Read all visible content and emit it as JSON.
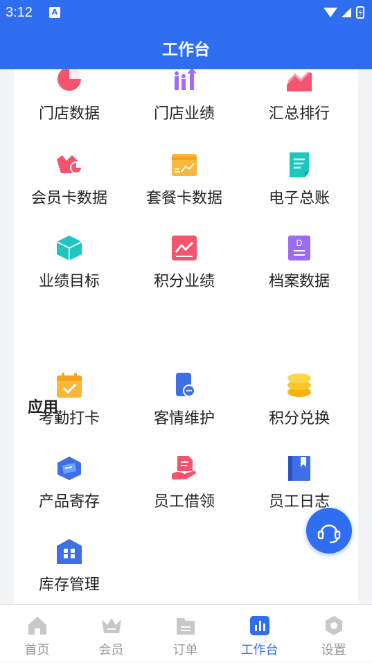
{
  "status_bar": {
    "time": "3:12",
    "sim_label": "A"
  },
  "header": {
    "title": "工作台"
  },
  "grid1": [
    {
      "label": "门店数据",
      "icon": "pie-chart-icon"
    },
    {
      "label": "门店业绩",
      "icon": "people-growth-icon"
    },
    {
      "label": "汇总排行",
      "icon": "trend-chart-icon"
    },
    {
      "label": "会员卡数据",
      "icon": "crown-chart-icon"
    },
    {
      "label": "套餐卡数据",
      "icon": "card-trend-icon"
    },
    {
      "label": "电子总账",
      "icon": "ledger-icon"
    },
    {
      "label": "业绩目标",
      "icon": "box-icon"
    },
    {
      "label": "积分业绩",
      "icon": "line-chart-icon"
    },
    {
      "label": "档案数据",
      "icon": "document-icon"
    }
  ],
  "apps_section": {
    "title": "应用"
  },
  "grid2": [
    {
      "label": "考勤打卡",
      "icon": "calendar-check-icon"
    },
    {
      "label": "客情维护",
      "icon": "phone-chat-icon"
    },
    {
      "label": "积分兑换",
      "icon": "coins-stack-icon"
    },
    {
      "label": "产品寄存",
      "icon": "package-icon"
    },
    {
      "label": "员工借领",
      "icon": "hand-doc-icon"
    },
    {
      "label": "员工日志",
      "icon": "notebook-icon"
    },
    {
      "label": "库存管理",
      "icon": "warehouse-icon"
    }
  ],
  "tabs": [
    {
      "label": "首页",
      "icon": "home-icon",
      "active": false
    },
    {
      "label": "会员",
      "icon": "crown-icon",
      "active": false
    },
    {
      "label": "订单",
      "icon": "folder-icon",
      "active": false
    },
    {
      "label": "工作台",
      "icon": "dashboard-icon",
      "active": true
    },
    {
      "label": "设置",
      "icon": "settings-icon",
      "active": false
    }
  ],
  "colors": {
    "brand": "#2f6ef0",
    "tab_inactive": "#9a9a9a"
  }
}
